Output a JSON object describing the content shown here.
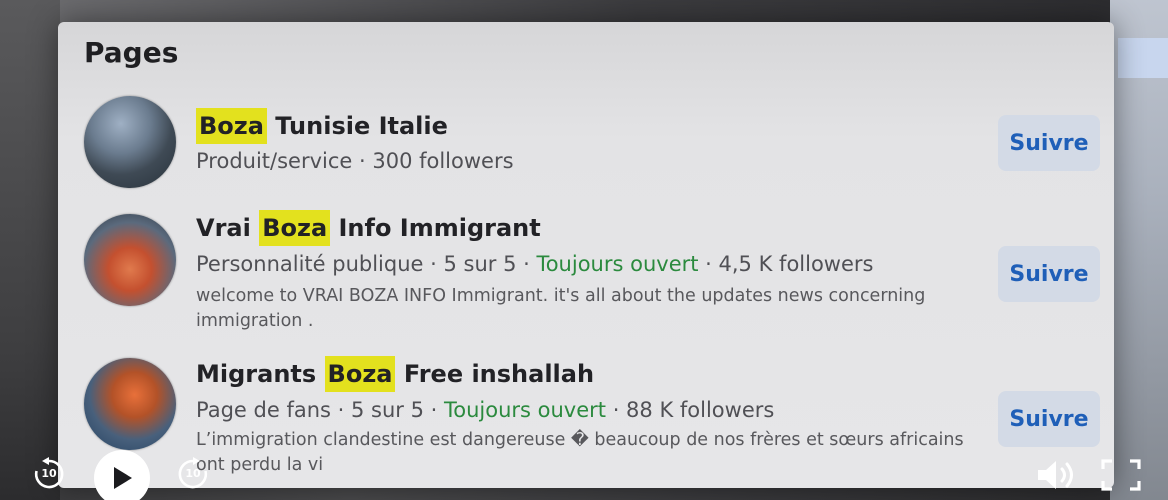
{
  "panel": {
    "title": "Pages"
  },
  "results": [
    {
      "name_highlight": "Boza",
      "name_prefix": "",
      "name_suffix": " Tunisie Italie",
      "meta_prefix": "Produit/service · 300 followers",
      "meta_status": "",
      "meta_suffix": "",
      "description": "",
      "action_label": "Suivre"
    },
    {
      "name_highlight": "Boza",
      "name_prefix": "Vrai ",
      "name_suffix": " Info Immigrant",
      "meta_prefix": "Personnalité publique · 5 sur 5 · ",
      "meta_status": "Toujours ouvert",
      "meta_suffix": " · 4,5 K followers",
      "description": "welcome to VRAI BOZA INFO Immigrant. it's all about the updates news concerning immigration .",
      "action_label": "Suivre"
    },
    {
      "name_highlight": "Boza",
      "name_prefix": "Migrants ",
      "name_suffix": " Free inshallah",
      "meta_prefix": "Page de fans · 5 sur 5 · ",
      "meta_status": "Toujours ouvert",
      "meta_suffix": " · 88 K followers",
      "description": "L’immigration clandestine est dangereuse � beaucoup de nos frères et sœurs africains ont perdu la vi",
      "action_label": "Suivre"
    }
  ],
  "player": {
    "rewind_seconds": "10",
    "forward_seconds": "10"
  },
  "colors": {
    "highlight": "#e3e11e",
    "status_green": "#2b8a3e",
    "button_text": "#1f5fb8",
    "button_bg": "#d3dae6"
  },
  "icons": {
    "rewind": "rewind-10-icon",
    "play": "play-icon",
    "forward": "forward-10-icon",
    "volume": "volume-icon",
    "fullscreen": "fullscreen-icon"
  }
}
